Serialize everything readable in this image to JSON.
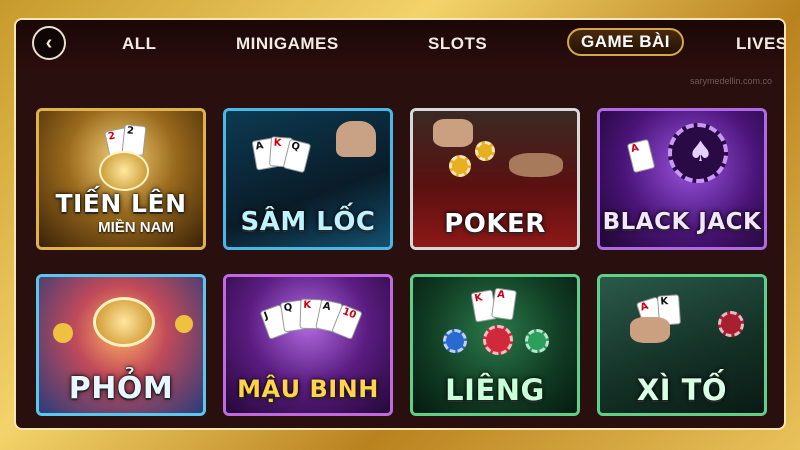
{
  "nav": {
    "back_glyph": "‹",
    "tabs": [
      {
        "label": "ALL",
        "active": false
      },
      {
        "label": "MINIGAMES",
        "active": false
      },
      {
        "label": "SLOTS",
        "active": false
      },
      {
        "label": "GAME BÀI",
        "active": true
      },
      {
        "label": "LIVES",
        "active": false
      }
    ]
  },
  "watermark": "sarymedellin.com.co",
  "games": [
    {
      "title": "TIẾN LÊN",
      "subtitle": "MIỀN NAM",
      "border": "#e0b24a",
      "accent": "#7a4b12"
    },
    {
      "title": "SÂM LỐC",
      "border": "#49b8e6",
      "accent": "#124a66"
    },
    {
      "title": "POKER",
      "border": "#d9d9d9",
      "accent": "#7a1212"
    },
    {
      "title": "BLACK JACK",
      "border": "#b06ae8",
      "accent": "#3e1466"
    },
    {
      "title": "PHỎM",
      "border": "#58c8f0",
      "accent": "#1b5e8c"
    },
    {
      "title": "MẬU BINH",
      "border": "#c06ae0",
      "accent": "#4e1670"
    },
    {
      "title": "LIÊNG",
      "border": "#5ed08a",
      "accent": "#145a34"
    },
    {
      "title": "XÌ TỐ",
      "border": "#5ed08a",
      "accent": "#1d4a3a"
    }
  ],
  "card_glyphs": [
    "A",
    "K",
    "Q",
    "J",
    "10",
    "2",
    "♠",
    "♥",
    "♣"
  ]
}
